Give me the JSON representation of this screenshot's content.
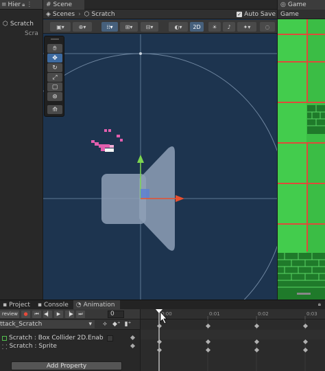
{
  "hierarchy": {
    "tab_label": "Hier",
    "root_item": "Scratch",
    "child_item": "Scra"
  },
  "scene": {
    "tab_label": "Scene",
    "breadcrumb_root": "Scenes",
    "breadcrumb_current": "Scratch",
    "autosave_label": "Auto Save",
    "mode_2d_label": "2D"
  },
  "game": {
    "tab_label": "Game",
    "sub_label": "Game"
  },
  "animation": {
    "tabs": [
      "Project",
      "Console",
      "Animation"
    ],
    "preview_label": "review",
    "frame_value": "0",
    "clip_name": "ttack_Scratch",
    "properties": [
      "Scratch : Box Collider 2D.Enab",
      "Scratch : Sprite"
    ],
    "add_property_label": "Add Property",
    "time_labels": [
      "0:00",
      "0:01",
      "0:02",
      "0:03"
    ]
  },
  "colors": {
    "scene_bg": "#1d344f",
    "game_green": "#3fc84a",
    "grid_red": "#e04a3a",
    "playhead": "#ffffff"
  }
}
